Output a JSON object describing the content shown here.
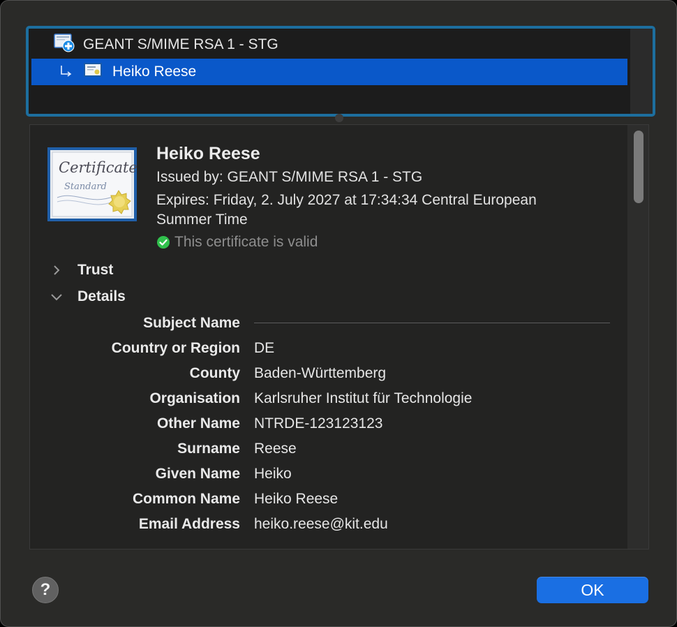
{
  "chain": {
    "root_label": "GEANT S/MIME RSA 1 - STG",
    "child_label": "Heiko Reese",
    "root_icon": "certificate-authority-icon",
    "child_icon": "certificate-icon",
    "selected_color": "#0a58c9",
    "focus_ring_color": "#1d6e9e"
  },
  "certificate": {
    "name": "Heiko Reese",
    "issued_by": "Issued by: GEANT S/MIME RSA 1 - STG",
    "expires_line1": "Expires: Friday, 2. July 2027 at 17:34:34 Central European",
    "expires_line2": "Summer Time",
    "validity": "This certificate is valid",
    "image_text_1": "Certificate",
    "image_text_2": "Standard"
  },
  "sections": {
    "trust": "Trust",
    "details": "Details"
  },
  "details": [
    {
      "label": "Subject Name",
      "value": ""
    },
    {
      "label": "Country or Region",
      "value": "DE"
    },
    {
      "label": "County",
      "value": "Baden-Württemberg"
    },
    {
      "label": "Organisation",
      "value": "Karlsruher Institut für Technologie"
    },
    {
      "label": "Other Name",
      "value": "NTRDE-123123123"
    },
    {
      "label": "Surname",
      "value": "Reese"
    },
    {
      "label": "Given Name",
      "value": "Heiko"
    },
    {
      "label": "Common Name",
      "value": "Heiko Reese"
    },
    {
      "label": "Email Address",
      "value": "heiko.reese@kit.edu"
    }
  ],
  "buttons": {
    "help": "?",
    "ok": "OK"
  },
  "colors": {
    "accent": "#1a6fe3",
    "valid_check": "#30c04c"
  }
}
